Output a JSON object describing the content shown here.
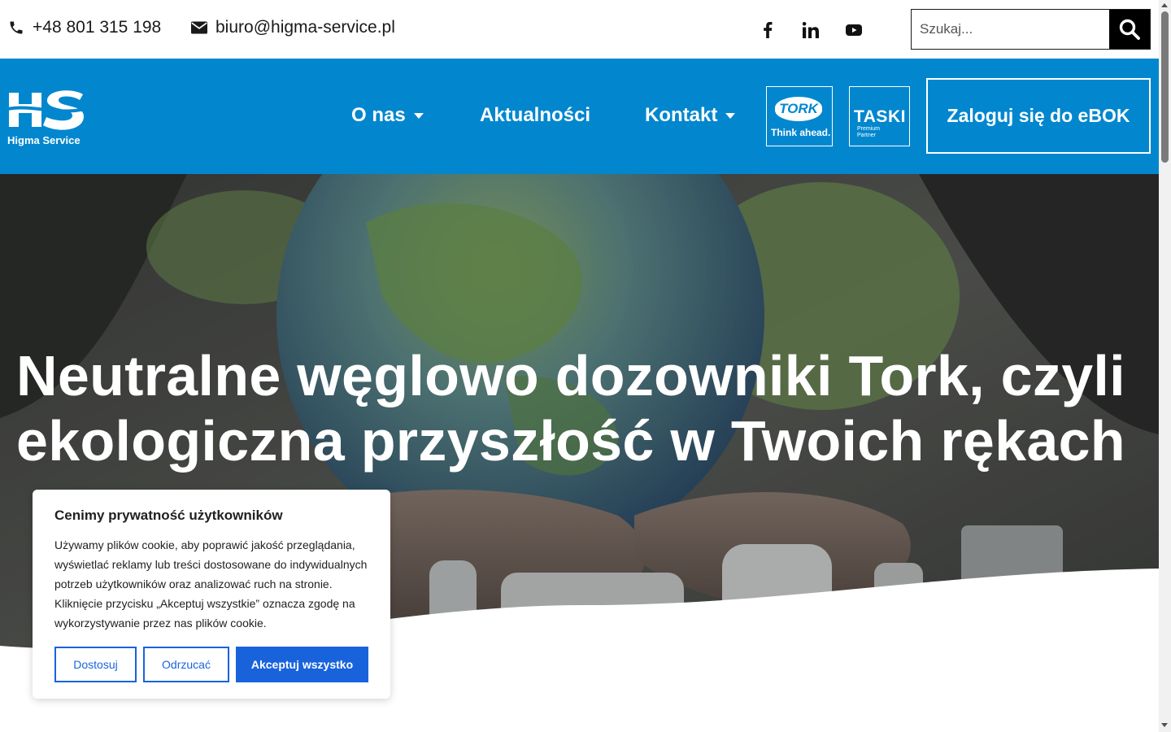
{
  "topbar": {
    "phone": "+48 801 315 198",
    "email": "biuro@higma-service.pl",
    "social_icons": [
      "facebook-icon",
      "linkedin-icon",
      "youtube-icon"
    ],
    "search": {
      "placeholder": "Szukaj..."
    }
  },
  "navbar": {
    "logo_text": "Higma Service",
    "items": [
      {
        "label": "O nas",
        "has_dropdown": true
      },
      {
        "label": "Aktualności",
        "has_dropdown": false
      },
      {
        "label": "Kontakt",
        "has_dropdown": true
      }
    ],
    "partners": {
      "tork": {
        "name": "TORK",
        "tagline": "Think ahead."
      },
      "taski": {
        "name": "TASKI",
        "sub1": "Premium",
        "sub2": "Partner"
      }
    },
    "login_label": "Zaloguj się do eBOK"
  },
  "hero": {
    "title": "Neutralne węglowo dozowniki Tork, czyli ekologiczna przyszłość w Twoich rękach"
  },
  "cookie_banner": {
    "title": "Cenimy prywatność użytkowników",
    "text": "Używamy plików cookie, aby poprawić jakość przeglądania, wyświetlać reklamy lub treści dostosowane do indywidualnych potrzeb użytkowników oraz analizować ruch na stronie. Kliknięcie przycisku „Akceptuj wszystkie” oznacza zgodę na wykorzystywanie przez nas plików cookie.",
    "buttons": {
      "customize": "Dostosuj",
      "reject": "Odrzucać",
      "accept": "Akceptuj wszystko"
    }
  },
  "colors": {
    "brand_blue": "#0287cf",
    "cookie_blue": "#1863dc",
    "topbar_bg": "#ffffff"
  }
}
